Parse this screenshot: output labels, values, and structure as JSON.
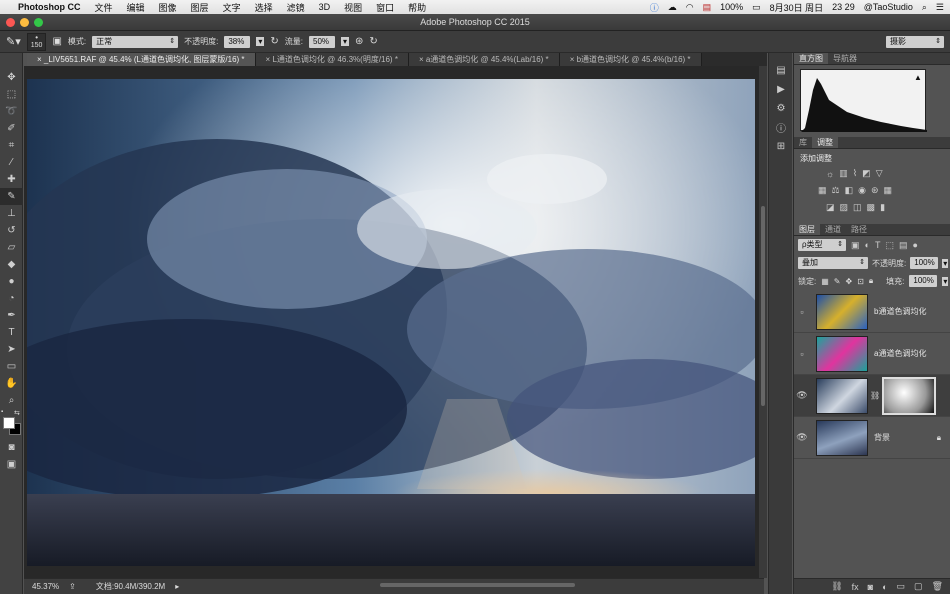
{
  "menubar": {
    "app": "Photoshop CC",
    "items": [
      "文件",
      "编辑",
      "图像",
      "图层",
      "文字",
      "选择",
      "滤镜",
      "3D",
      "视图",
      "窗口",
      "帮助"
    ],
    "battery": "100%",
    "date": "8月30日 周日",
    "time": "23 29",
    "user": "@TaoStudio"
  },
  "window": {
    "title": "Adobe Photoshop CC 2015"
  },
  "options": {
    "brush_size": "150",
    "mode_label": "模式:",
    "mode_value": "正常",
    "opacity_label": "不透明度:",
    "opacity_value": "38%",
    "flow_label": "流量:",
    "flow_value": "50%",
    "workspace": "摄影"
  },
  "tabs": [
    "_LIV5651.RAF @ 45.4% (L通道色调均化, 图层蒙版/16) *",
    "L通道色调均化 @ 46.3%(明度/16) *",
    "a通道色调均化 @ 45.4%(Lab/16) *",
    "b通道色调均化 @ 45.4%(b/16) *"
  ],
  "status": {
    "zoom": "45.37%",
    "doc": "文档:90.4M/390.2M"
  },
  "histogram_panel": {
    "tabs": [
      "直方图",
      "导航器"
    ]
  },
  "adjust_panel": {
    "tabs": [
      "库",
      "调整"
    ],
    "title": "添加调整"
  },
  "layers_panel": {
    "tabs": [
      "图层",
      "通道",
      "路径"
    ],
    "filter": "ρ类型",
    "blend": "叠加",
    "opacity_label": "不透明度:",
    "opacity_value": "100%",
    "lock_label": "锁定:",
    "fill_label": "填充:",
    "fill_value": "100%",
    "layers": [
      {
        "name": "b通道色调均化",
        "visible": false
      },
      {
        "name": "a通道色调均化",
        "visible": false
      },
      {
        "name": "",
        "visible": true
      },
      {
        "name": "背景",
        "visible": true
      }
    ]
  }
}
